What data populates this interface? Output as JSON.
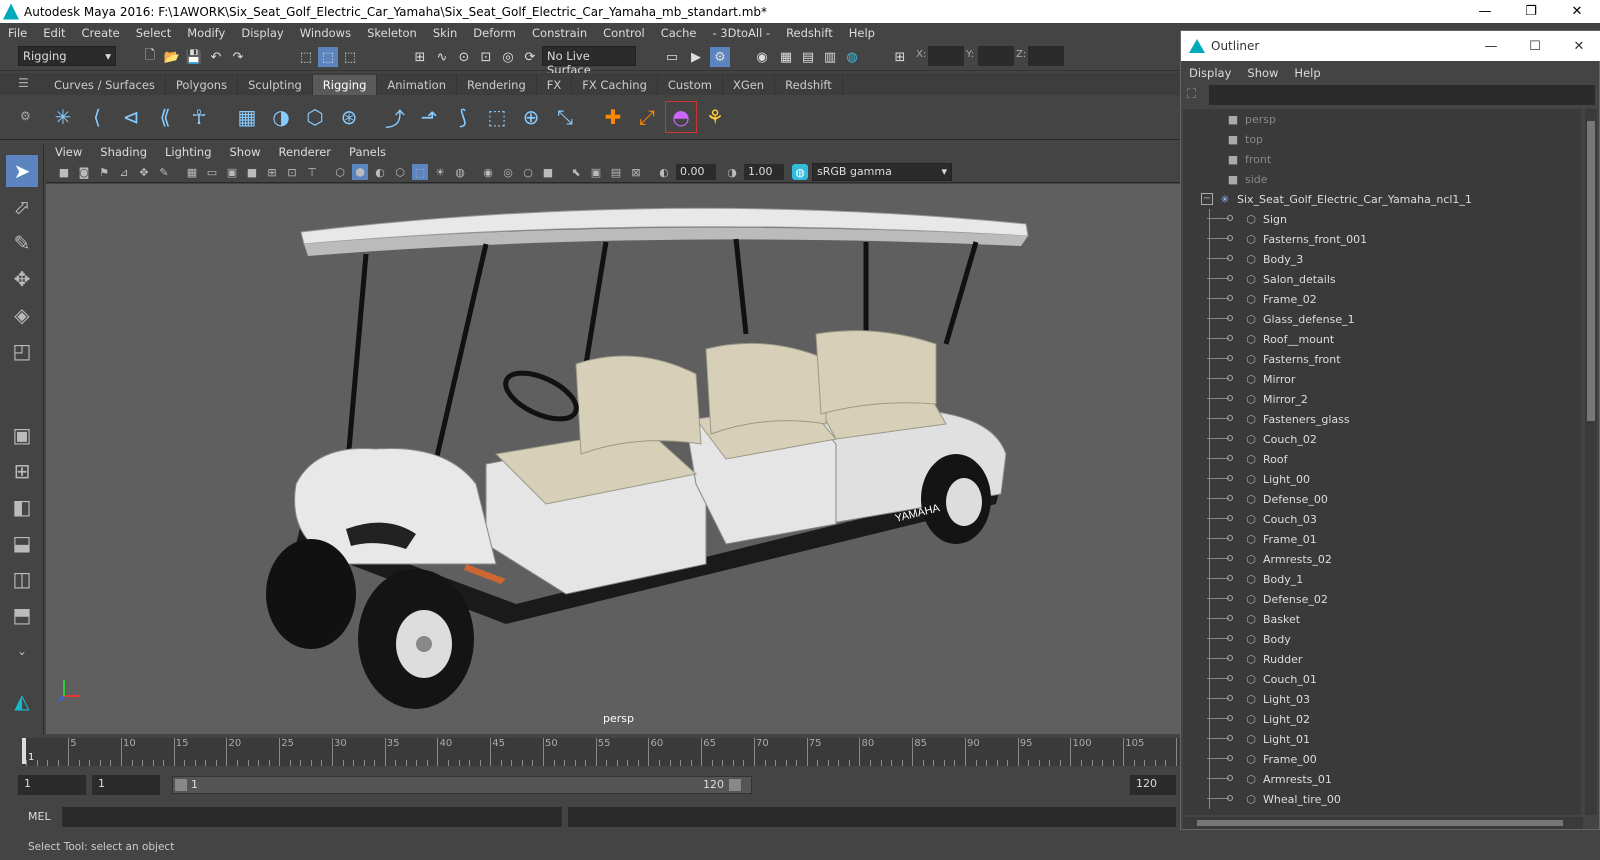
{
  "window": {
    "title": "Autodesk Maya 2016: F:\\1AWORK\\Six_Seat_Golf_Electric_Car_Yamaha\\Six_Seat_Golf_Electric_Car_Yamaha_mb_standart.mb*",
    "minimize": "—",
    "maximize": "❐",
    "close": "✕"
  },
  "menu": [
    "File",
    "Edit",
    "Create",
    "Select",
    "Modify",
    "Display",
    "Windows",
    "Skeleton",
    "Skin",
    "Deform",
    "Constrain",
    "Control",
    "Cache",
    "- 3DtoAll -",
    "Redshift",
    "Help"
  ],
  "status": {
    "mode": "Rigging",
    "live_surface": "No Live Surface",
    "x_label": "X:",
    "y_label": "Y:",
    "z_label": "Z:"
  },
  "shelf_tabs": [
    "Curves / Surfaces",
    "Polygons",
    "Sculpting",
    "Rigging",
    "Animation",
    "Rendering",
    "FX",
    "FX Caching",
    "Custom",
    "XGen",
    "Redshift"
  ],
  "active_shelf": "Rigging",
  "viewport": {
    "menu": [
      "View",
      "Shading",
      "Lighting",
      "Show",
      "Renderer",
      "Panels"
    ],
    "exposure": "0.00",
    "gamma_val": "1.00",
    "color_space": "sRGB gamma",
    "camera": "persp",
    "brand": "YAMAHA"
  },
  "timeline": {
    "ticks": [
      "5",
      "10",
      "15",
      "20",
      "25",
      "30",
      "35",
      "40",
      "45",
      "50",
      "55",
      "60",
      "65",
      "70",
      "75",
      "80",
      "85",
      "90",
      "95",
      "100",
      "105"
    ],
    "current_frame": "1"
  },
  "range": {
    "start": "1",
    "start2": "1",
    "slider_start": "1",
    "slider_end": "120",
    "end": "120"
  },
  "mel": {
    "label": "MEL"
  },
  "help": "Select Tool: select an object",
  "outliner": {
    "title": "Outliner",
    "minimize": "—",
    "maximize": "☐",
    "close": "✕",
    "menu": [
      "Display",
      "Show",
      "Help"
    ],
    "cameras": [
      "persp",
      "top",
      "front",
      "side"
    ],
    "group": "Six_Seat_Golf_Electric_Car_Yamaha_ncl1_1",
    "items": [
      "Sign",
      "Fasterns_front_001",
      "Body_3",
      "Salon_details",
      "Frame_02",
      "Glass_defense_1",
      "Roof__mount",
      "Fasterns_front",
      "Mirror",
      "Mirror_2",
      "Fasteners_glass",
      "Couch_02",
      "Roof",
      "Light_00",
      "Defense_00",
      "Couch_03",
      "Frame_01",
      "Armrests_02",
      "Body_1",
      "Defense_02",
      "Basket",
      "Body",
      "Rudder",
      "Couch_01",
      "Light_03",
      "Light_02",
      "Light_01",
      "Frame_00",
      "Armrests_01",
      "Wheal_tire_00"
    ]
  }
}
